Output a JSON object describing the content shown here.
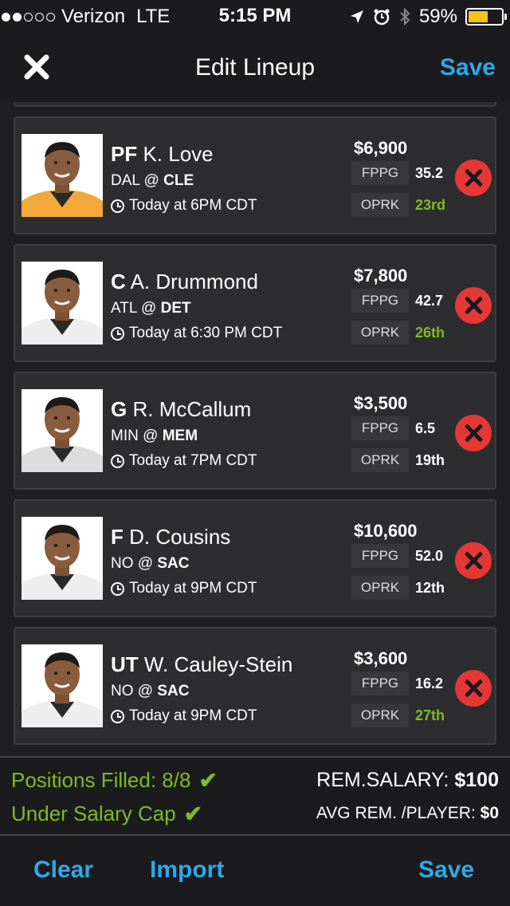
{
  "status_bar": {
    "carrier": "Verizon",
    "network": "LTE",
    "time": "5:15 PM",
    "battery_percent": "59%",
    "battery_level": 0.59,
    "battery_color": "#f2c318",
    "icons": [
      "location-arrow-icon",
      "alarm-icon",
      "bluetooth-icon"
    ]
  },
  "nav": {
    "close_icon": "close-icon",
    "title": "Edit Lineup",
    "save_label": "Save"
  },
  "players": [
    {
      "pos": "PF",
      "name": "K. Love",
      "away": "DAL",
      "home": "CLE",
      "time": "Today at 6PM CDT",
      "salary": "$6,900",
      "fppg_label": "FPPG",
      "fppg": "35.2",
      "oprk_label": "OPRK",
      "oprk": "23rd",
      "oprk_color": "green",
      "jersey": "#f2a93b"
    },
    {
      "pos": "C",
      "name": "A. Drummond",
      "away": "ATL",
      "home": "DET",
      "time": "Today at 6:30 PM CDT",
      "salary": "$7,800",
      "fppg_label": "FPPG",
      "fppg": "42.7",
      "oprk_label": "OPRK",
      "oprk": "26th",
      "oprk_color": "green",
      "jersey": "#eeeeee"
    },
    {
      "pos": "G",
      "name": "R. McCallum",
      "away": "MIN",
      "home": "MEM",
      "time": "Today at 7PM CDT",
      "salary": "$3,500",
      "fppg_label": "FPPG",
      "fppg": "6.5",
      "oprk_label": "OPRK",
      "oprk": "19th",
      "oprk_color": "white",
      "jersey": "#dddddd"
    },
    {
      "pos": "F",
      "name": "D. Cousins",
      "away": "NO",
      "home": "SAC",
      "time": "Today at 9PM CDT",
      "salary": "$10,600",
      "fppg_label": "FPPG",
      "fppg": "52.0",
      "oprk_label": "OPRK",
      "oprk": "12th",
      "oprk_color": "white",
      "jersey": "#eeeeee"
    },
    {
      "pos": "UT",
      "name": "W. Cauley-Stein",
      "away": "NO",
      "home": "SAC",
      "time": "Today at 9PM CDT",
      "salary": "$3,600",
      "fppg_label": "FPPG",
      "fppg": "16.2",
      "oprk_label": "OPRK",
      "oprk": "27th",
      "oprk_color": "green",
      "jersey": "#eeeeee"
    }
  ],
  "summary": {
    "positions_filled": "Positions Filled: 8/8",
    "under_cap": "Under Salary Cap",
    "rem_salary_label": "REM.SALARY:",
    "rem_salary_value": "$100",
    "avg_rem_label": "AVG REM. /PLAYER:",
    "avg_rem_value": "$0",
    "check_icon": "checkmark-icon"
  },
  "toolbar": {
    "clear_label": "Clear",
    "import_label": "Import",
    "save_label": "Save"
  },
  "colors": {
    "accent": "#2ea8e8",
    "green": "#7dbb26",
    "remove": "#e63737",
    "background": "#1b1b1d",
    "card": "#2d2d30"
  }
}
